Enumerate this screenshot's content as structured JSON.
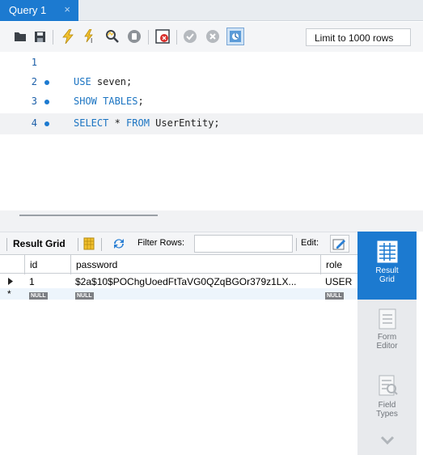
{
  "tab": {
    "title": "Query 1",
    "close": "×"
  },
  "toolbar": {
    "limit_select": "Limit to 1000 rows",
    "icons": [
      "folder-icon",
      "save-icon",
      "execute-icon",
      "execute-statement-icon",
      "explain-icon",
      "stop-icon",
      "toggle-error-icon",
      "commit-icon",
      "rollback-icon",
      "autocommit-icon"
    ]
  },
  "editor": {
    "lines": [
      {
        "num": "1",
        "kw": "",
        "rest": ""
      },
      {
        "num": "2",
        "kw": "USE",
        "rest": " seven;"
      },
      {
        "num": "3",
        "kw": "SHOW TABLES",
        "rest": ";"
      },
      {
        "num": "4",
        "kw": "SELECT",
        "mid": " * ",
        "kw2": "FROM",
        "rest": " UserEntity;"
      }
    ]
  },
  "result": {
    "grid_label": "Result Grid",
    "filter_label": "Filter Rows:",
    "filter_value": "",
    "edit_label": "Edit:",
    "columns": [
      "id",
      "password",
      "role"
    ],
    "rows": [
      {
        "id": "1",
        "password": "$2a$10$POChgUoedFtTaVG0QZqBGOr379z1LX...",
        "role": "USER"
      }
    ],
    "null_text": "NULL"
  },
  "side": {
    "result_grid": [
      "Result",
      "Grid"
    ],
    "form_editor": [
      "Form",
      "Editor"
    ],
    "field_types": [
      "Field",
      "Types"
    ]
  },
  "colors": {
    "accent": "#1c7ad0",
    "keyword": "#1b74c2"
  }
}
